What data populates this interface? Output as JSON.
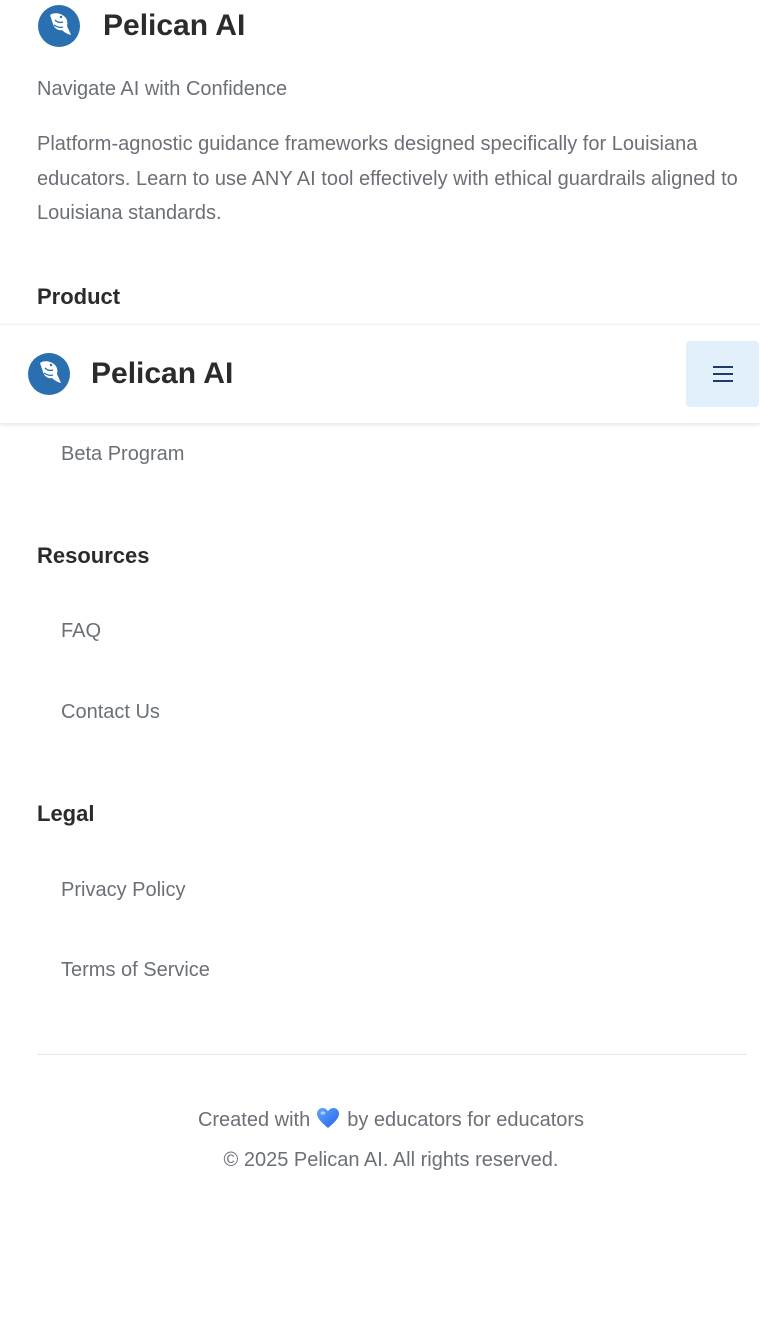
{
  "brand": {
    "name": "Pelican AI",
    "tagline": "Navigate AI with Confidence",
    "description": "Platform-agnostic guidance frameworks designed specifically for Louisiana educators. Learn to use ANY AI tool effectively with ethical guardrails aligned to Louisiana standards."
  },
  "sections": {
    "product": {
      "title": "Product",
      "links": [
        "Beta Program"
      ]
    },
    "resources": {
      "title": "Resources",
      "links": [
        "FAQ",
        "Contact Us"
      ]
    },
    "legal": {
      "title": "Legal",
      "links": [
        "Privacy Policy",
        "Terms of Service"
      ]
    }
  },
  "credit": {
    "before": "Created with",
    "heart_icon": "heart-icon",
    "after": "by educators for educators",
    "copyright": "© 2025 Pelican AI. All rights reserved."
  },
  "header": {
    "title": "Pelican AI",
    "menu_icon": "hamburger-menu-icon"
  },
  "colors": {
    "logo_blue": "#2a6fb0",
    "heading_text": "#2b2b2b",
    "muted_text": "#6b6f76",
    "menu_button_bg": "#e2f0fc",
    "menu_icon_color": "#1f3a6b",
    "heart_blue": "#3b82f6"
  }
}
